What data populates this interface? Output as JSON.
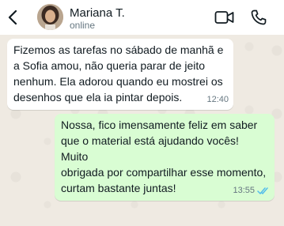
{
  "header": {
    "contact_name": "Mariana T.",
    "status": "online"
  },
  "messages": [
    {
      "direction": "incoming",
      "text": "Fizemos as tarefas no sábado de manhã e\na Sofia amou, não queria parar de jeito\nnenhum. Ela adorou quando eu mostrei os\ndesenhos que ela ia pintar depois.",
      "time": "12:40"
    },
    {
      "direction": "outgoing",
      "text": "Nossa, fico imensamente feliz em saber\nque o material está ajudando vocês! Muito\nobrigada por compartilhar esse momento,\ncurtam bastante juntas!",
      "time": "13:55",
      "status": "read"
    }
  ],
  "icons": {
    "back": "chevron-left-icon",
    "video": "video-camera-icon",
    "call": "phone-icon",
    "read_receipt": "double-check-icon"
  },
  "colors": {
    "header_bg": "#ffffff",
    "chat_bg": "#efeae2",
    "incoming_bubble": "#ffffff",
    "outgoing_bubble": "#d9fdd3",
    "read_tick": "#53bdeb"
  }
}
